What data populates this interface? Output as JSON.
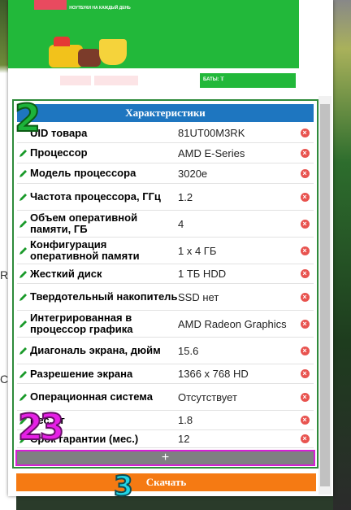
{
  "banner": {
    "tagline": "НОУТБУКИ НА КАЖДЫЙ ДЕНЬ",
    "footer_box_text": "БАТЫ: 𝕋"
  },
  "widget": {
    "title": "Характеристики",
    "rows": [
      {
        "name": "UID товара",
        "value": "81UT00M3RK",
        "editable": false
      },
      {
        "name": "Процессор",
        "value": "AMD E-Series",
        "editable": true
      },
      {
        "name": "Модель процессора",
        "value": "3020e",
        "editable": true
      },
      {
        "name": "Частота процессора, ГГц",
        "value": "1.2",
        "editable": true
      },
      {
        "name": "Объем оперативной памяти, ГБ",
        "value": "4",
        "editable": true
      },
      {
        "name": "Конфигурация оперативной памяти",
        "value": "1 x 4 ГБ",
        "editable": true
      },
      {
        "name": "Жесткий диск",
        "value": "1 ТБ HDD",
        "editable": true
      },
      {
        "name": "Твердотельный накопитель",
        "value": "SSD нет",
        "editable": true
      },
      {
        "name": "Интегрированная в процессор графика",
        "value": "AMD Radeon Graphics",
        "editable": true
      },
      {
        "name": "Диагональ экрана, дюйм",
        "value": "15.6",
        "editable": true
      },
      {
        "name": "Разрешение экрана",
        "value": "1366 x 768 HD",
        "editable": true
      },
      {
        "name": "Операционная система",
        "value": "Отсутствует",
        "editable": true
      },
      {
        "name": "Вес, кг",
        "value": "1.8",
        "editable": true
      },
      {
        "name": "Срок гарантии (мес.)",
        "value": "12",
        "editable": true
      }
    ],
    "add_label": "+",
    "download_label": "Скачать"
  },
  "annotations": {
    "a1": "2",
    "a2": "23",
    "a3": "3"
  },
  "colors": {
    "header": "#1e76c0",
    "pen": "#1a9a2a",
    "delete": "#e8534f",
    "download": "#f57a13",
    "add_bar": "#7f8082"
  }
}
